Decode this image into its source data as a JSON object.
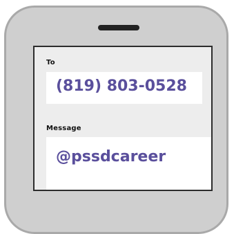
{
  "sms": {
    "to_label": "To",
    "to_value": "(819) 803-0528",
    "message_label": "Message",
    "message_value": "@pssdcareer"
  },
  "colors": {
    "accent": "#5a4f9c",
    "phone_body": "#cfcfcf",
    "screen_bg": "#ededed"
  }
}
